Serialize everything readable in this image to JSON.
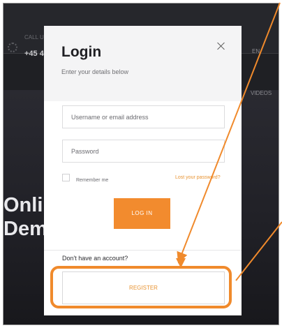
{
  "background": {
    "phone_label": "CALL US",
    "phone": "+45 4",
    "language": "EN",
    "videos": "VIDEOS",
    "hero_line1": "Onli",
    "hero_line2": "Dem"
  },
  "modal": {
    "title": "Login",
    "subtitle": "Enter your details below",
    "username_placeholder": "Username or email address",
    "password_placeholder": "Password",
    "remember_label": "Remember me",
    "lost_password": "Lost your password?",
    "login_button": "LOG IN",
    "no_account": "Don't have an account?",
    "register_button": "REGISTER"
  },
  "icons": {
    "close": "close-icon",
    "location": "location-icon"
  },
  "colors": {
    "accent": "#f28b2e",
    "annotation": "#f08a2c",
    "overlay_dark": "#232328"
  }
}
